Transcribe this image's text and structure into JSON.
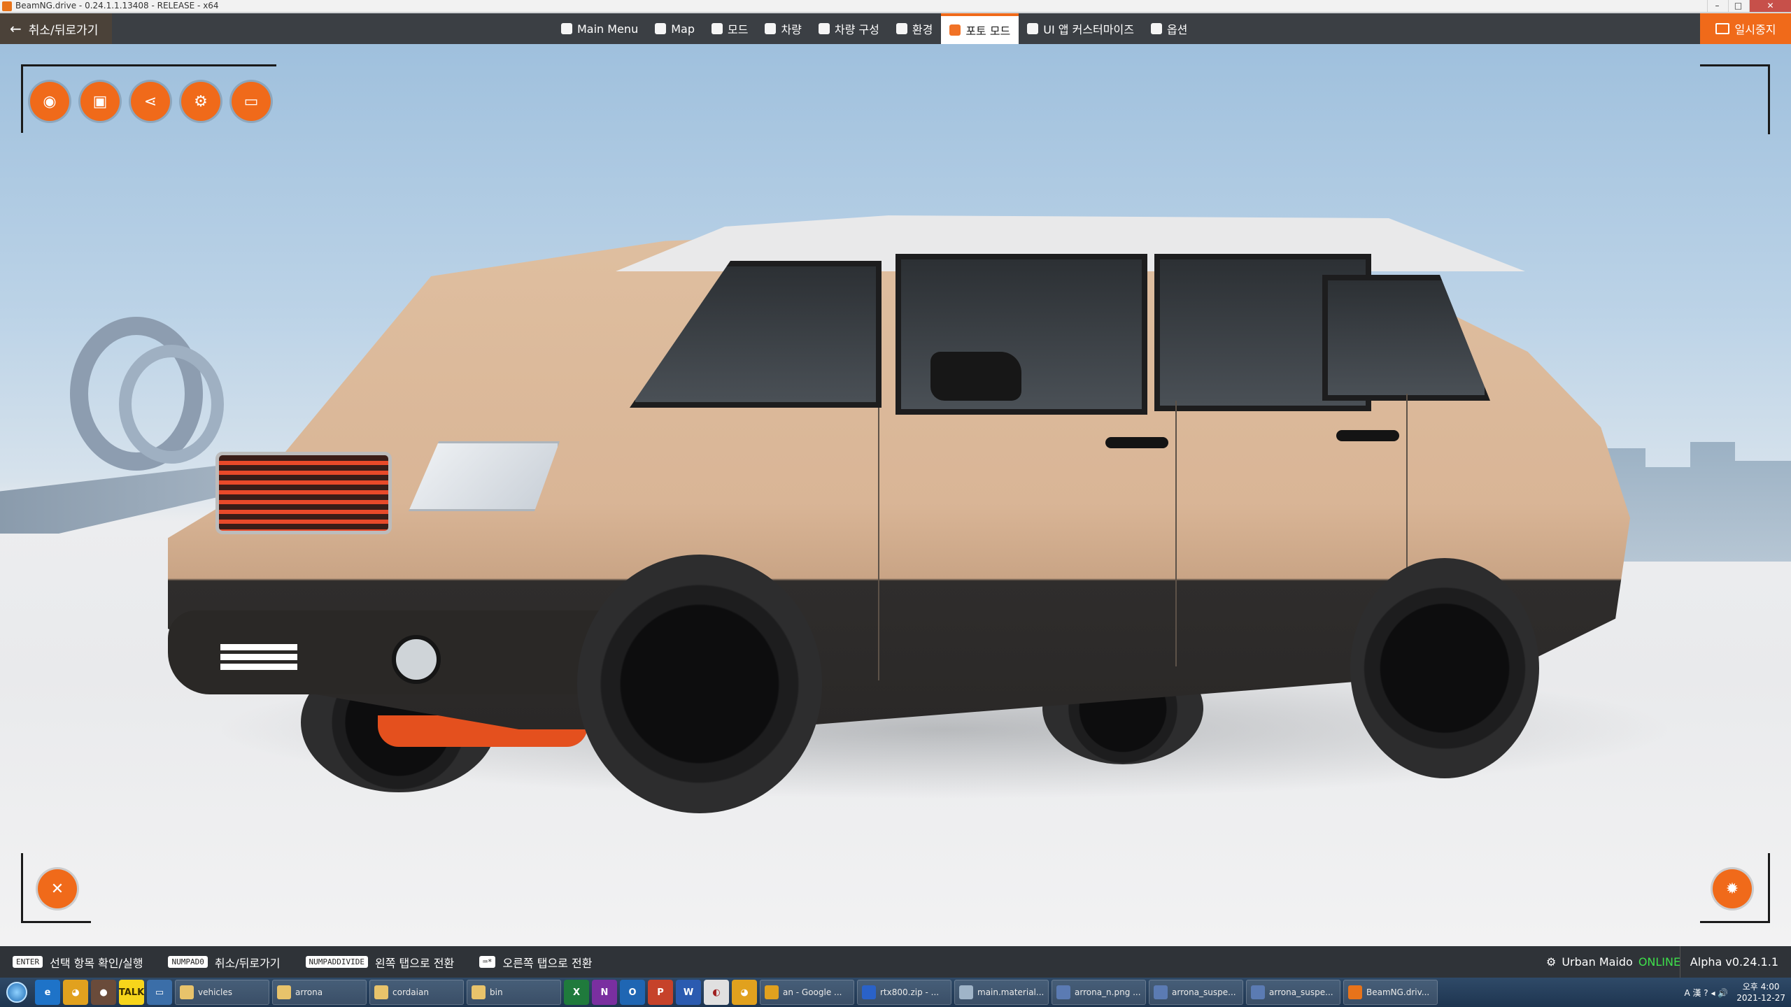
{
  "window": {
    "title": "BeamNG.drive - 0.24.1.1.13408 - RELEASE - x64"
  },
  "topbar": {
    "back_label": "취소/뒤로가기",
    "pause_label": "일시중지",
    "nav": [
      {
        "label": "Main Menu",
        "icon": "grid-icon"
      },
      {
        "label": "Map",
        "icon": "map-icon"
      },
      {
        "label": "모드",
        "icon": "puzzle-icon"
      },
      {
        "label": "차량",
        "icon": "car-icon"
      },
      {
        "label": "차량 구성",
        "icon": "car-config-icon"
      },
      {
        "label": "환경",
        "icon": "weather-icon"
      },
      {
        "label": "포토 모드",
        "icon": "camera-icon",
        "active": true
      },
      {
        "label": "UI 앱 커스터마이즈",
        "icon": "ui-apps-icon"
      },
      {
        "label": "옵션",
        "icon": "sliders-icon"
      }
    ]
  },
  "photo_mode": {
    "tools": [
      "camera-icon",
      "image-icon",
      "share-icon",
      "steam-icon",
      "folder-icon"
    ],
    "close_icon": "close-icon",
    "settings_icon": "gear-icon"
  },
  "hints": [
    {
      "key": "ENTER",
      "label": "선택 항목 확인/실행"
    },
    {
      "key": "NUMPAD0",
      "label": "취소/뒤로가기"
    },
    {
      "key": "NUMPADDIVIDE",
      "label": "왼쪽 탭으로 전환"
    },
    {
      "key": "",
      "label": "오른쪽 탭으로 전환"
    }
  ],
  "status": {
    "user": "Urban Maido",
    "online": "ONLINE",
    "version": "Alpha v0.24.1.1"
  },
  "taskbar": {
    "tasks": [
      "vehicles",
      "arrona",
      "cordaian",
      "bin",
      "an - Google ...",
      "rtx800.zip - ...",
      "main.material...",
      "arrona_n.png ...",
      "arrona_suspe...",
      "arrona_suspe...",
      "BeamNG.driv..."
    ],
    "time": "오후 4:00",
    "date": "2021-12-27"
  },
  "colors": {
    "accent": "#f06a1a",
    "bar": "#3b3f44",
    "online": "#3ee04b"
  }
}
